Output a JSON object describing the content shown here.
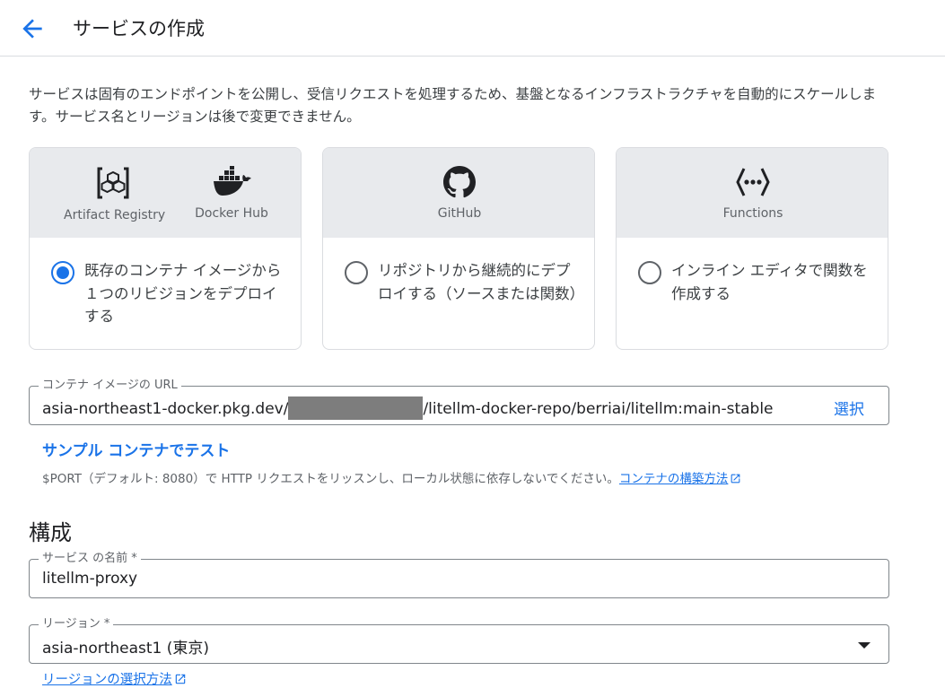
{
  "header": {
    "title": "サービスの作成"
  },
  "description": "サービスは固有のエンドポイントを公開し、受信リクエストを処理するため、基盤となるインフラストラクチャを自動的にスケールします。サービス名とリージョンは後で変更できません。",
  "deploy_options": [
    {
      "logos": [
        "Artifact Registry",
        "Docker Hub"
      ],
      "label": "既存のコンテナ イメージから１つのリビジョンをデプロイする",
      "selected": true
    },
    {
      "logos": [
        "GitHub"
      ],
      "label": "リポジトリから継続的にデプロイする（ソースまたは関数）",
      "selected": false
    },
    {
      "logos": [
        "Functions"
      ],
      "label": "インライン エディタで関数を作成する",
      "selected": false
    }
  ],
  "container_image": {
    "label": "コンテナ イメージの URL",
    "value_prefix": "asia-northeast1-docker.pkg.dev/",
    "value_suffix": "/litellm-docker-repo/berriai/litellm:main-stable",
    "select_label": "選択"
  },
  "sample_link": "サンプル コンテナでテスト",
  "hint": {
    "text": "$PORT（デフォルト: 8080）で HTTP リクエストをリッスンし、ローカル状態に依存しないでください。",
    "link": "コンテナの構築方法"
  },
  "config": {
    "section_title": "構成",
    "service_name": {
      "label": "サービス の名前 *",
      "value": "litellm-proxy"
    },
    "region": {
      "label": "リージョン *",
      "value": "asia-northeast1 (東京)"
    },
    "region_help": "リージョンの選択方法"
  },
  "colors": {
    "accent": "#1a73e8",
    "card_header_bg": "#e8eaed",
    "border": "#dadce0"
  }
}
